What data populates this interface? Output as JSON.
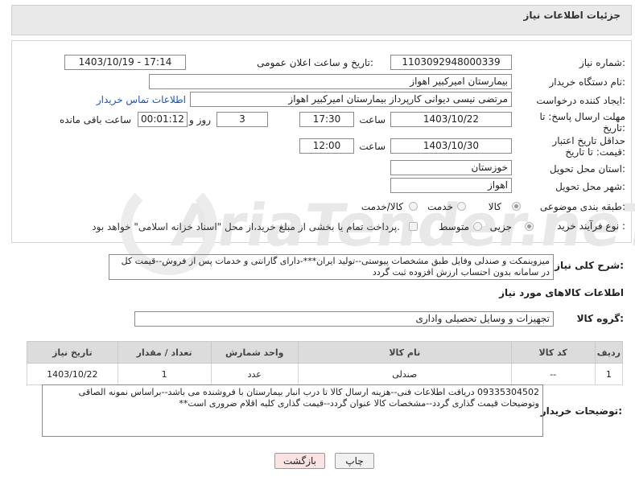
{
  "panel": {
    "title": "جزئیات اطلاعات نیاز"
  },
  "watermark": "AriaTender.neT",
  "form": {
    "need_number_label": "شماره نیاز:",
    "need_number": "1103092948000339",
    "announce_label": "تاریخ و ساعت اعلان عمومی:",
    "announce_value": "1403/10/19 - 17:14",
    "buyer_label": "نام دستگاه خریدار:",
    "buyer_value": "بیمارستان امیرکبیر اهواز",
    "creator_label": "ایجاد کننده درخواست:",
    "creator_value": "مرتضی نیسی دیوانی کارپرداز بیمارستان امیرکبیر اهواز",
    "contact_link": "اطلاعات تماس خریدار",
    "deadline_label": "مهلت ارسال پاسخ: تا تاریخ:",
    "deadline_date": "1403/10/22",
    "time_label": "ساعت",
    "deadline_time": "17:30",
    "days_value": "3",
    "days_label": "روز و",
    "remaining_time": "00:01:12",
    "remaining_label": "ساعت باقی مانده",
    "min_validity_label": "حداقل تاریخ اعتبار قیمت: تا تاریخ:",
    "validity_date": "1403/10/30",
    "validity_time": "12:00",
    "province_label": "استان محل تحویل:",
    "province_value": "خوزستان",
    "city_label": "شهر محل تحویل:",
    "city_value": "اهواز",
    "category_label": "طبقه بندی موضوعی:",
    "category_options": [
      "کالا",
      "خدمت",
      "کالا/خدمت"
    ],
    "category_selected": "کالا",
    "process_label": "نوع فرآیند خرید :",
    "process_options": [
      "جزیی",
      "متوسط"
    ],
    "process_selected": "جزیی",
    "payment_note": "پرداخت تمام یا بخشی از مبلغ خرید،از محل \"اسناد خزانه اسلامی\" خواهد بود."
  },
  "summary": {
    "label": "شرح کلی نیاز:",
    "text": "میزوینمکت و صندلی وفایل طبق مشخصات پیوستی--تولید ایران***-دارای گارانتی و خدمات پس از فروش--قیمت کل در سامانه بدون احتساب ارزش افزوده ثبت گردد"
  },
  "goods": {
    "section_title": "اطلاعات کالاهای مورد نیاز",
    "group_label": "گروه کالا:",
    "group_value": "تجهیزات و وسایل تحصیلی واداری",
    "columns": [
      "ردیف",
      "کد کالا",
      "نام کالا",
      "واحد شمارش",
      "تعداد / مقدار",
      "تاریخ نیاز"
    ],
    "rows": [
      [
        "1",
        "--",
        "صندلی",
        "عدد",
        "1",
        "1403/10/22"
      ]
    ]
  },
  "buyer_notes": {
    "label": "توضیحات خریدار:",
    "text": "09335304502 دریافت اطلاعات فنی--هزینه ارسال کالا تا درب انبار بیمارستان با فروشنده می باشد--براساس نمونه الصاقی وتوضیحات قیمت گذاری گردد--مشخصات کالا عنوان گردد--قیمت گذاری کلیه اقلام ضروری است**"
  },
  "buttons": {
    "print": "چاپ",
    "back": "بازگشت"
  }
}
